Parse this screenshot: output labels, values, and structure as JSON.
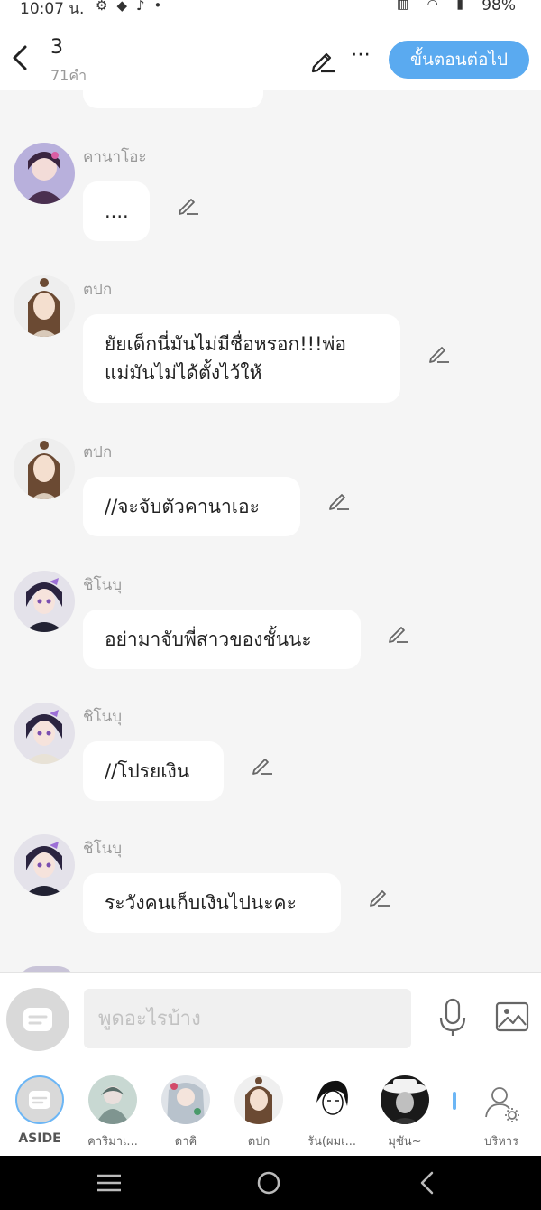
{
  "status_bar": {
    "time": "10:07 น.",
    "battery": "98%"
  },
  "header": {
    "title": "3",
    "subtitle": "71คำ",
    "next_label": "ขั้นตอนต่อไป"
  },
  "messages": [
    {
      "sender": "คานาโอะ",
      "text": "....",
      "avatar": "kanao-avatar"
    },
    {
      "sender": "ตปก",
      "text_lines": [
        "ยัยเด็กนี่มันไม่มีชื่อหรอก!!!พ่อ",
        "แม่มันไม่ได้ตั้งไว้ให้"
      ],
      "avatar": "tpk-avatar"
    },
    {
      "sender": "ตปก",
      "text": "//จะจับตัวคานาเอะ",
      "avatar": "tpk-avatar"
    },
    {
      "sender": "ชิโนบุ",
      "text": "อย่ามาจับพี่สาวของชั้นนะ",
      "avatar": "shinobu-avatar"
    },
    {
      "sender": "ชิโนบุ",
      "text": "//โปรยเงิน",
      "avatar": "shinobu-avatar"
    },
    {
      "sender": "ชิโนบุ",
      "text": "ระวังคนเก็บเงินไปนะคะ",
      "avatar": "shinobu-avatar"
    }
  ],
  "input": {
    "placeholder": "พูดอะไรบ้าง"
  },
  "cast": [
    {
      "label": "ASIDE"
    },
    {
      "label": "คาริมาเ..."
    },
    {
      "label": "ดาคิ"
    },
    {
      "label": "ตปก"
    },
    {
      "label": "รัน(ผมเ..."
    },
    {
      "label": "มุซัน~"
    },
    {
      "label": "บริหาร"
    }
  ],
  "colors": {
    "accent": "#5aaaf0",
    "bubble": "#ffffff",
    "background": "#f5f5f5"
  }
}
